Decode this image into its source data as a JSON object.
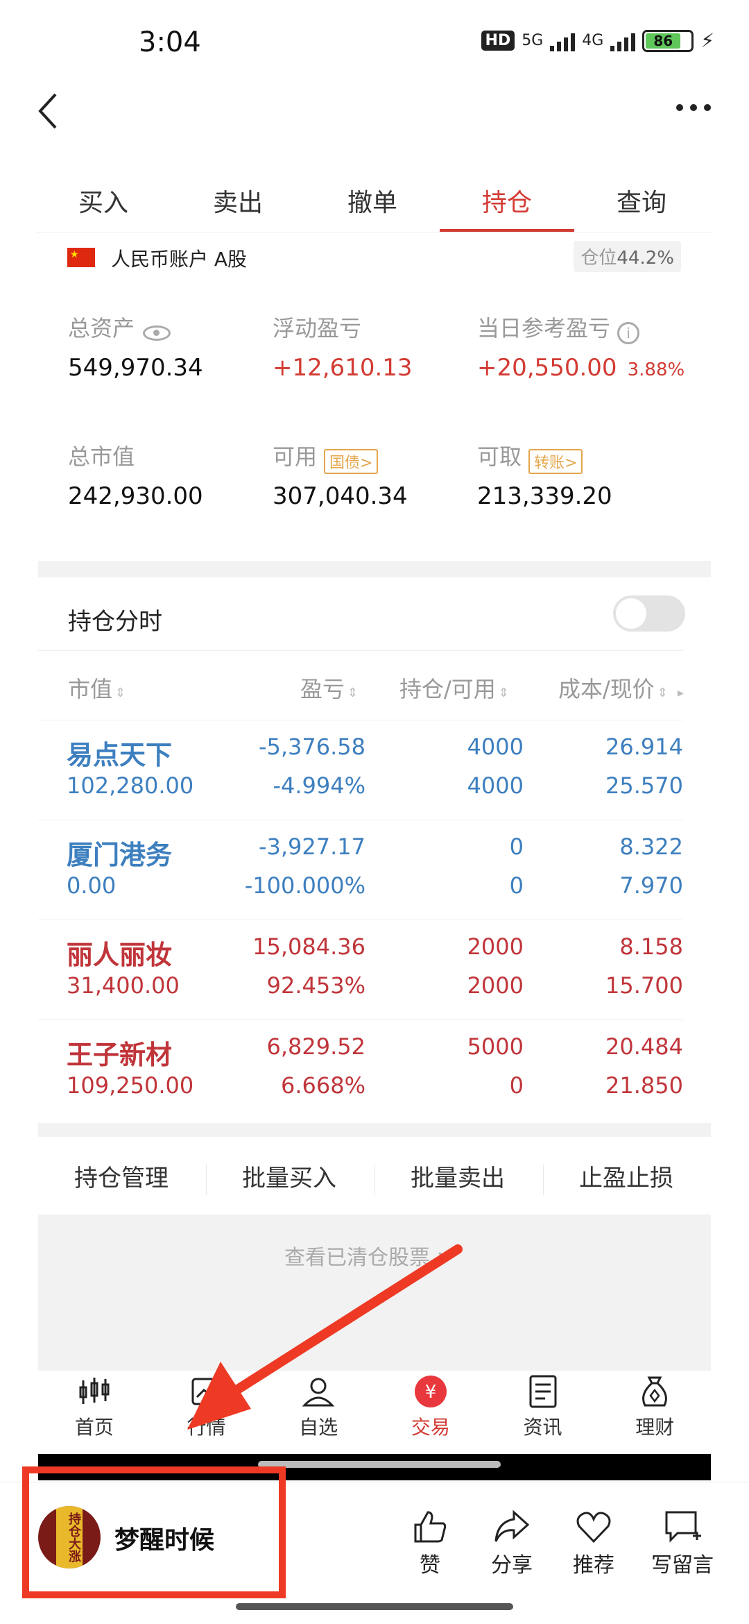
{
  "status_bar": {
    "time": "3:04",
    "network_5g": "5G",
    "network_4g": "4G",
    "battery": "86",
    "hd_label": "HD"
  },
  "tabs": [
    {
      "label": "买入"
    },
    {
      "label": "卖出"
    },
    {
      "label": "撤单"
    },
    {
      "label": "持仓",
      "active": true
    },
    {
      "label": "查询"
    }
  ],
  "account": {
    "label": "人民币账户 A股",
    "position_label": "仓位",
    "position_value": "44.2%"
  },
  "assets": {
    "total_assets_label": "总资产",
    "total_assets_value": "549,970.34",
    "floating_pnl_label": "浮动盈亏",
    "floating_pnl_value": "+12,610.13",
    "daily_pnl_label": "当日参考盈亏",
    "daily_pnl_value": "+20,550.00",
    "daily_pnl_pct": "3.88%",
    "market_value_label": "总市值",
    "market_value_value": "242,930.00",
    "available_label": "可用",
    "available_tag": "国债>",
    "available_value": "307,040.34",
    "withdrawable_label": "可取",
    "withdrawable_tag": "转账>",
    "withdrawable_value": "213,339.20"
  },
  "holdings_section": {
    "title": "持仓分时"
  },
  "table": {
    "headers": [
      "市值",
      "盈亏",
      "持仓/可用",
      "成本/现价"
    ],
    "rows": [
      {
        "name": "易点天下",
        "market_value": "102,280.00",
        "pnl": "-5,376.58",
        "pnl_pct": "-4.994%",
        "hold": "4000",
        "avail": "4000",
        "cost": "26.914",
        "price": "25.570",
        "color": "#3d7fbf"
      },
      {
        "name": "厦门港务",
        "market_value": "0.00",
        "pnl": "-3,927.17",
        "pnl_pct": "-100.000%",
        "hold": "0",
        "avail": "0",
        "cost": "8.322",
        "price": "7.970",
        "color": "#3d7fbf"
      },
      {
        "name": "丽人丽妆",
        "market_value": "31,400.00",
        "pnl": "15,084.36",
        "pnl_pct": "92.453%",
        "hold": "2000",
        "avail": "2000",
        "cost": "8.158",
        "price": "15.700",
        "color": "#c0353a"
      },
      {
        "name": "王子新材",
        "market_value": "109,250.00",
        "pnl": "6,829.52",
        "pnl_pct": "6.668%",
        "hold": "5000",
        "avail": "0",
        "cost": "20.484",
        "price": "21.850",
        "color": "#c0353a"
      }
    ]
  },
  "actions": [
    "持仓管理",
    "批量买入",
    "批量卖出",
    "止盈止损"
  ],
  "cleared_link": "查看已清仓股票 >",
  "bottom_nav": [
    {
      "label": "首页",
      "icon": "candlestick-icon"
    },
    {
      "label": "行情",
      "icon": "chart-icon"
    },
    {
      "label": "自选",
      "icon": "user-star-icon"
    },
    {
      "label": "交易",
      "icon": "yuan-icon",
      "active": true
    },
    {
      "label": "资讯",
      "icon": "document-icon"
    },
    {
      "label": "理财",
      "icon": "money-bag-icon"
    }
  ],
  "comment_bar": {
    "username": "梦醒时候",
    "avatar_text": "持仓大涨",
    "like": "赞",
    "share": "分享",
    "recommend": "推荐",
    "comment": "写留言"
  },
  "colors": {
    "accent_red": "#d23b33",
    "loss_blue": "#3d7fbf",
    "tag_orange": "#e4a64c",
    "overlay_red": "#ee3a24"
  }
}
